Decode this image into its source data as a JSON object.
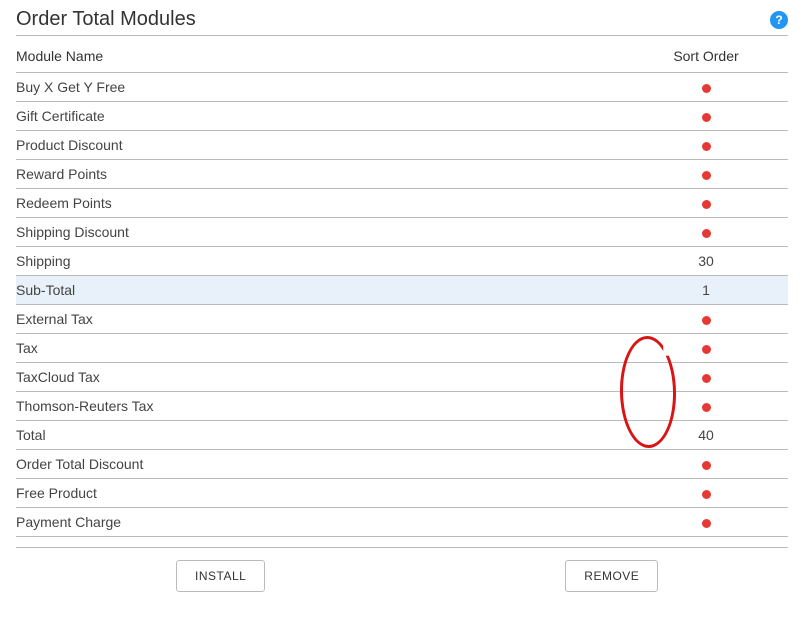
{
  "header": {
    "title": "Order Total Modules",
    "help_tooltip": "?"
  },
  "table": {
    "columns": {
      "name": "Module Name",
      "sort": "Sort Order"
    },
    "rows": [
      {
        "name": "Buy X Get Y Free",
        "sort": null,
        "selected": false
      },
      {
        "name": "Gift Certificate",
        "sort": null,
        "selected": false
      },
      {
        "name": "Product Discount",
        "sort": null,
        "selected": false
      },
      {
        "name": "Reward Points",
        "sort": null,
        "selected": false
      },
      {
        "name": "Redeem Points",
        "sort": null,
        "selected": false
      },
      {
        "name": "Shipping Discount",
        "sort": null,
        "selected": false
      },
      {
        "name": "Shipping",
        "sort": "30",
        "selected": false
      },
      {
        "name": "Sub-Total",
        "sort": "1",
        "selected": true
      },
      {
        "name": "External Tax",
        "sort": null,
        "selected": false
      },
      {
        "name": "Tax",
        "sort": null,
        "selected": false
      },
      {
        "name": "TaxCloud Tax",
        "sort": null,
        "selected": false
      },
      {
        "name": "Thomson-Reuters Tax",
        "sort": null,
        "selected": false
      },
      {
        "name": "Total",
        "sort": "40",
        "selected": false,
        "obscured": true
      },
      {
        "name": "Order Total Discount",
        "sort": null,
        "selected": false
      },
      {
        "name": "Free Product",
        "sort": null,
        "selected": false
      },
      {
        "name": "Payment Charge",
        "sort": null,
        "selected": false
      }
    ]
  },
  "buttons": {
    "install": "INSTALL",
    "remove": "REMOVE"
  },
  "annotation": {
    "description": "red-oval-circling-tax-module-dots",
    "circled_rows": [
      "Tax",
      "TaxCloud Tax",
      "Thomson-Reuters Tax"
    ]
  }
}
